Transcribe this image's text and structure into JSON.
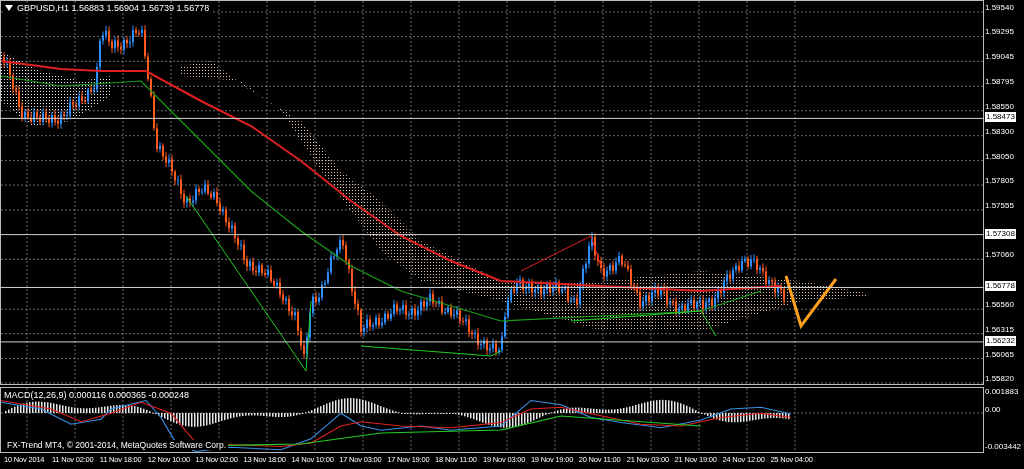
{
  "chart": {
    "title": "GBPUSD,H1 1.56883 1.56904 1.56739 1.56778"
  },
  "price_axis": [
    {
      "label": "1.59540",
      "kind": "tick"
    },
    {
      "label": "1.59295",
      "kind": "tick"
    },
    {
      "label": "1.59045",
      "kind": "tick"
    },
    {
      "label": "1.58795",
      "kind": "tick"
    },
    {
      "label": "1.58550",
      "kind": "tick"
    },
    {
      "label": "1.58473",
      "kind": "level"
    },
    {
      "label": "1.58300",
      "kind": "tick"
    },
    {
      "label": "1.58050",
      "kind": "tick"
    },
    {
      "label": "1.57805",
      "kind": "tick"
    },
    {
      "label": "1.57555",
      "kind": "tick"
    },
    {
      "label": "1.57308",
      "kind": "level"
    },
    {
      "label": "1.57060",
      "kind": "tick"
    },
    {
      "label": "1.56778",
      "kind": "level"
    },
    {
      "label": "1.56560",
      "kind": "tick"
    },
    {
      "label": "1.56315",
      "kind": "tick"
    },
    {
      "label": "1.56232",
      "kind": "level"
    },
    {
      "label": "1.56065",
      "kind": "tick"
    },
    {
      "label": "1.55820",
      "kind": "tick"
    }
  ],
  "macd": {
    "title": "MACD(12,26,9) 0.000116 0.000365 -0.000248",
    "axis": [
      "0.001883",
      "0.00",
      "-0.003442"
    ],
    "copyright": "FX-Trend MT4, © 2001-2014, MetaQuotes Software Corp."
  },
  "time_axis": [
    "10 Nov 2014",
    "11 Nov 02:00",
    "11 Nov 18:00",
    "12 Nov 10:00",
    "13 Nov 02:00",
    "13 Nov 18:00",
    "14 Nov 10:00",
    "17 Nov 03:00",
    "17 Nov 19:00",
    "18 Nov 11:00",
    "19 Nov 03:00",
    "19 Nov 19:00",
    "20 Nov 11:00",
    "21 Nov 03:00",
    "21 Nov 19:00",
    "24 Nov 12:00",
    "25 Nov 04:00"
  ]
}
